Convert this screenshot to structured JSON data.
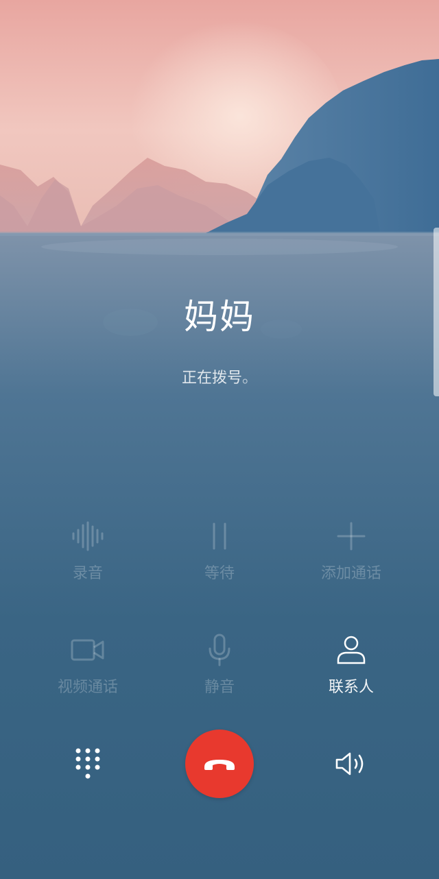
{
  "caller": {
    "name": "妈妈",
    "status": "正在拨号",
    "status_dot": "。"
  },
  "actions_row1": [
    {
      "label": "录音",
      "icon": "waveform-icon",
      "enabled": false
    },
    {
      "label": "等待",
      "icon": "pause-icon",
      "enabled": false
    },
    {
      "label": "添加通话",
      "icon": "plus-icon",
      "enabled": false
    }
  ],
  "actions_row2": [
    {
      "label": "视频通话",
      "icon": "video-camera-icon",
      "enabled": false
    },
    {
      "label": "静音",
      "icon": "microphone-icon",
      "enabled": false
    },
    {
      "label": "联系人",
      "icon": "person-icon",
      "enabled": true
    }
  ],
  "bottom_bar": {
    "dialpad_icon": "dialpad-icon",
    "end_call_icon": "phone-hangup-icon",
    "speaker_icon": "speaker-icon"
  },
  "colors": {
    "end_call": "#e8392e",
    "background": "#35607f"
  }
}
